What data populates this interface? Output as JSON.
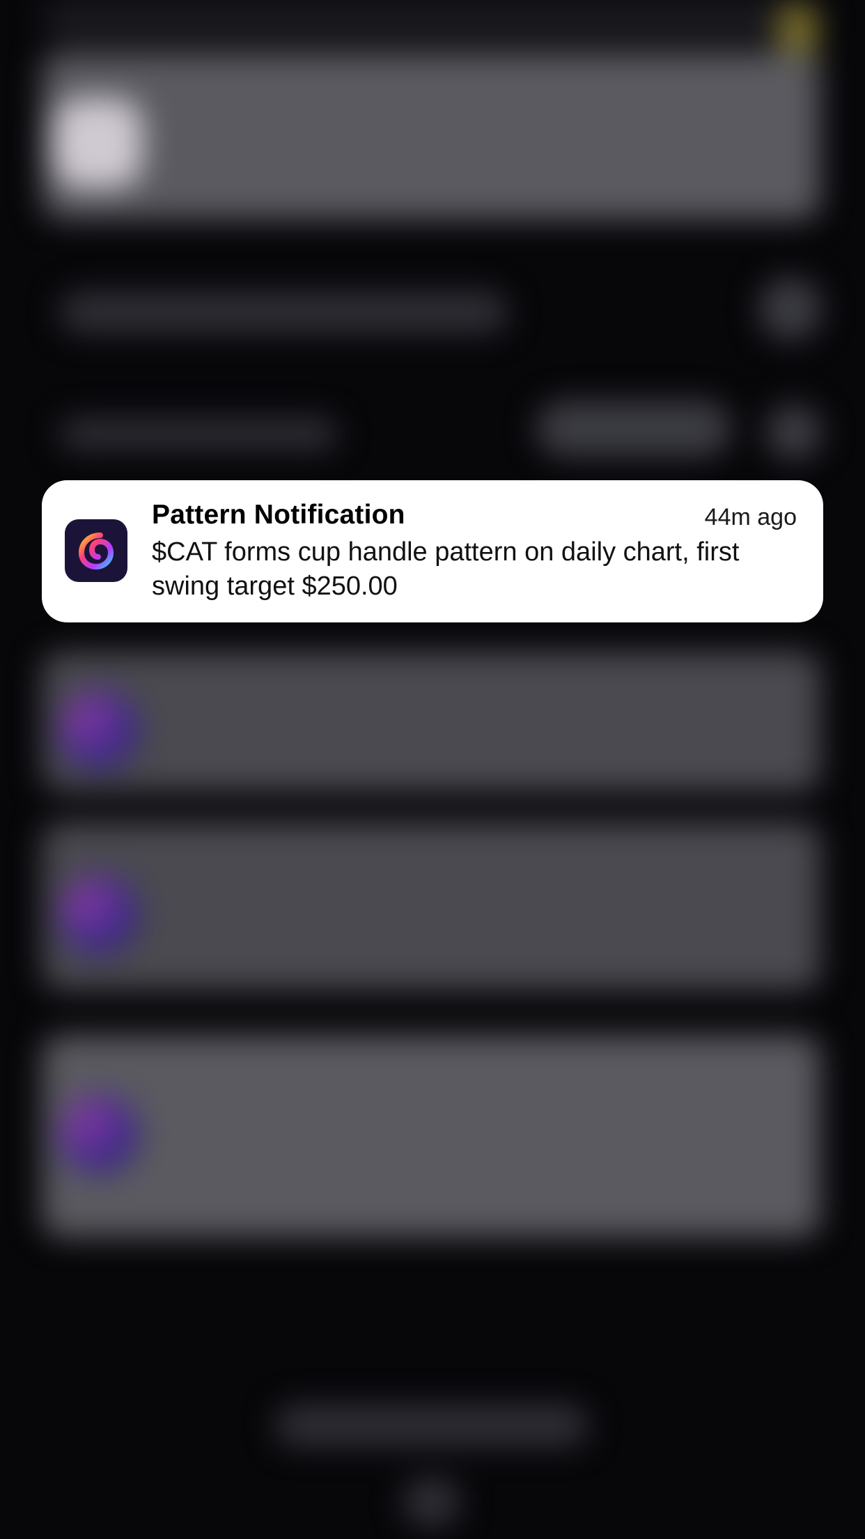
{
  "notification": {
    "app_icon": "pattern-app-icon",
    "title": "Pattern Notification",
    "time": "44m ago",
    "body": "$CAT forms cup handle pattern on daily chart, first swing target $250.00"
  },
  "colors": {
    "background": "#07070a",
    "card": "#ffffff",
    "icon_bg": "#1c1438"
  }
}
